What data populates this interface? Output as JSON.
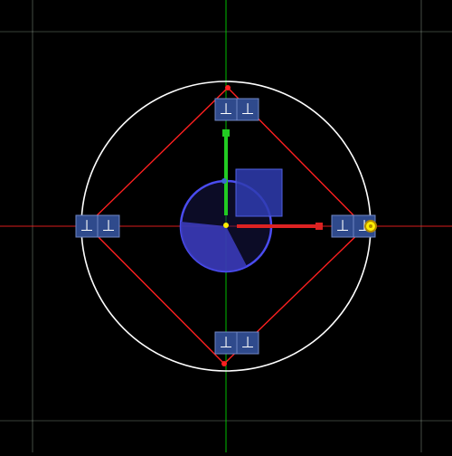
{
  "editor": {
    "colors": {
      "background": "#000000",
      "grid_line": "#cfe8cf",
      "axis_x": "#ff2020",
      "axis_y": "#00dd00",
      "bounding_circle": "#ffffff",
      "constraint_polygon": "#ff2020",
      "gizmo_ring": "#4a4cf0",
      "gizmo_fill": "#2d2da0",
      "handle_box": "#2f3cb0",
      "move_handle_x": "#dd2222",
      "move_handle_y": "#22cc22",
      "pivot": "#ffee00",
      "constraint_tag_bg": "#2f4a8c"
    },
    "constraint_tag_glyph": "⊥",
    "pivot_marker": "pivot-yellow",
    "rotation_slice": "sector"
  }
}
